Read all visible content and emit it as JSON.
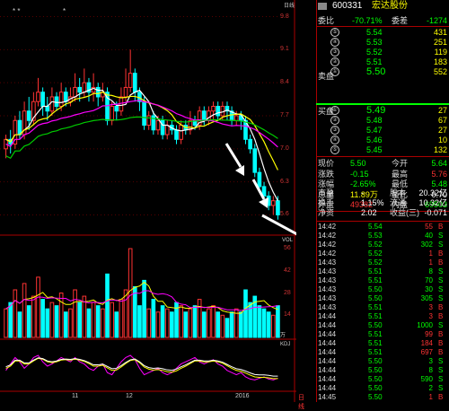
{
  "colors": {
    "up": "#ff3333",
    "down": "#00ffff",
    "ma5": "#ffffff",
    "ma10": "#ffff00",
    "ma20": "#ff00ff",
    "ma60": "#00cc00",
    "arrow": "#ffffff"
  },
  "chart": {
    "top_marks": "* *",
    "top_right_label": "日线",
    "price_ticks": [
      "9.8",
      "9.1",
      "8.4",
      "7.7",
      "7.0",
      "6.3",
      "5.6"
    ],
    "vol_label": "VOL",
    "vol_ticks": [
      "56",
      "42",
      "28",
      "14"
    ],
    "vol_unit": "万",
    "macd_label": "KDJ",
    "date_labels": [
      "11",
      "12",
      "2016"
    ],
    "bottom_unit": "日线",
    "arrow_icon": "down-arrow-icon"
  },
  "header": {
    "code": "600331",
    "name": "宏达股份"
  },
  "stats": {
    "weibi_label": "委比",
    "weibi_value": "-70.71%",
    "weicha_label": "委差",
    "weicha_value": "-1274"
  },
  "sell_label": "卖盘",
  "buy_label": "买盘",
  "asks": [
    {
      "level": "⑤",
      "price": "5.54",
      "vol": "431"
    },
    {
      "level": "④",
      "price": "5.53",
      "vol": "251"
    },
    {
      "level": "③",
      "price": "5.52",
      "vol": "119"
    },
    {
      "level": "②",
      "price": "5.51",
      "vol": "183"
    },
    {
      "level": "①",
      "price": "5.50",
      "vol": "552"
    }
  ],
  "bids": [
    {
      "level": "①",
      "price": "5.49",
      "vol": "27"
    },
    {
      "level": "②",
      "price": "5.48",
      "vol": "67"
    },
    {
      "level": "③",
      "price": "5.47",
      "vol": "27"
    },
    {
      "level": "④",
      "price": "5.46",
      "vol": "10"
    },
    {
      "level": "⑤",
      "price": "5.45",
      "vol": "132"
    }
  ],
  "quote": [
    {
      "l1": "现价",
      "v1": "5.50",
      "l2": "今开",
      "v2": "5.64"
    },
    {
      "l1": "涨跌",
      "v1": "-0.15",
      "l2": "最高",
      "v2": "5.76"
    },
    {
      "l1": "涨幅",
      "v1": "-2.65%",
      "l2": "最低",
      "v2": "5.48"
    },
    {
      "l1": "总量",
      "v1": "11.89万",
      "l2": "量比",
      "v2": "0.70"
    },
    {
      "l1": "外盘",
      "v1": "49382",
      "l2": "内盘",
      "v2": "69503"
    }
  ],
  "fund": [
    {
      "l1": "市盈",
      "v1": "-",
      "l2": "股本",
      "v2": "20.32亿"
    },
    {
      "l1": "换手",
      "v1": "1.15%",
      "l2": "流通",
      "v2": "10.32亿"
    },
    {
      "l1": "净资",
      "v1": "2.02",
      "l2": "收益(三)",
      "v2": "-0.071"
    }
  ],
  "ticks": [
    {
      "time": "14:42",
      "price": "5.54",
      "vol": "55",
      "dir": "B"
    },
    {
      "time": "14:42",
      "price": "5.53",
      "vol": "40",
      "dir": "S"
    },
    {
      "time": "14:42",
      "price": "5.52",
      "vol": "302",
      "dir": "S"
    },
    {
      "time": "14:42",
      "price": "5.52",
      "vol": "1",
      "dir": "B"
    },
    {
      "time": "14:43",
      "price": "5.52",
      "vol": "1",
      "dir": "B"
    },
    {
      "time": "14:43",
      "price": "5.51",
      "vol": "8",
      "dir": "S"
    },
    {
      "time": "14:43",
      "price": "5.51",
      "vol": "70",
      "dir": "S"
    },
    {
      "time": "14:43",
      "price": "5.50",
      "vol": "30",
      "dir": "S"
    },
    {
      "time": "14:43",
      "price": "5.50",
      "vol": "305",
      "dir": "S"
    },
    {
      "time": "14:43",
      "price": "5.51",
      "vol": "3",
      "dir": "B"
    },
    {
      "time": "14:44",
      "price": "5.51",
      "vol": "3",
      "dir": "B"
    },
    {
      "time": "14:44",
      "price": "5.50",
      "vol": "1000",
      "dir": "S"
    },
    {
      "time": "14:44",
      "price": "5.51",
      "vol": "99",
      "dir": "B"
    },
    {
      "time": "14:44",
      "price": "5.51",
      "vol": "184",
      "dir": "B"
    },
    {
      "time": "14:44",
      "price": "5.51",
      "vol": "697",
      "dir": "B"
    },
    {
      "time": "14:44",
      "price": "5.50",
      "vol": "3",
      "dir": "S"
    },
    {
      "time": "14:44",
      "price": "5.50",
      "vol": "8",
      "dir": "S"
    },
    {
      "time": "14:44",
      "price": "5.50",
      "vol": "590",
      "dir": "S"
    },
    {
      "time": "14:44",
      "price": "5.50",
      "vol": "2",
      "dir": "S"
    },
    {
      "time": "14:45",
      "price": "5.50",
      "vol": "1",
      "dir": "B"
    }
  ],
  "candles": [
    [
      7.0,
      7.2,
      6.8,
      7.3
    ],
    [
      7.2,
      7.1,
      6.9,
      7.4
    ],
    [
      7.1,
      7.6,
      7.0,
      7.7
    ],
    [
      7.6,
      7.3,
      7.2,
      7.8
    ],
    [
      7.3,
      7.8,
      7.2,
      8.0
    ],
    [
      7.8,
      7.6,
      7.4,
      8.1
    ],
    [
      7.6,
      8.0,
      7.5,
      8.2
    ],
    [
      8.0,
      8.2,
      7.9,
      8.5
    ],
    [
      8.2,
      7.9,
      7.7,
      8.3
    ],
    [
      7.9,
      7.8,
      7.6,
      8.1
    ],
    [
      7.8,
      8.1,
      7.7,
      8.3
    ],
    [
      8.1,
      7.9,
      7.8,
      8.2
    ],
    [
      7.9,
      8.2,
      7.8,
      8.4
    ],
    [
      8.2,
      8.0,
      7.9,
      8.3
    ],
    [
      8.0,
      8.1,
      7.9,
      8.3
    ],
    [
      8.1,
      8.3,
      8.0,
      8.6
    ],
    [
      8.3,
      8.2,
      8.0,
      8.5
    ],
    [
      8.2,
      8.4,
      8.1,
      8.7
    ],
    [
      8.4,
      8.2,
      8.0,
      8.5
    ],
    [
      8.2,
      8.3,
      8.0,
      8.6
    ],
    [
      8.3,
      8.1,
      7.9,
      8.4
    ],
    [
      8.1,
      8.2,
      8.0,
      8.4
    ],
    [
      8.2,
      7.6,
      7.5,
      8.3
    ],
    [
      7.6,
      7.9,
      7.5,
      8.0
    ],
    [
      7.9,
      7.8,
      7.6,
      8.0
    ],
    [
      7.8,
      8.1,
      7.7,
      8.3
    ],
    [
      8.1,
      8.3,
      8.0,
      8.7
    ],
    [
      8.3,
      8.6,
      8.2,
      9.1
    ],
    [
      8.6,
      8.2,
      8.0,
      8.7
    ],
    [
      8.2,
      8.0,
      7.8,
      8.3
    ],
    [
      8.0,
      7.5,
      7.4,
      8.1
    ],
    [
      7.5,
      7.7,
      7.4,
      7.8
    ],
    [
      7.7,
      7.4,
      7.3,
      7.8
    ],
    [
      7.4,
      7.6,
      7.3,
      7.7
    ],
    [
      7.6,
      7.3,
      7.2,
      7.7
    ],
    [
      7.3,
      7.5,
      7.2,
      7.6
    ],
    [
      7.5,
      7.4,
      7.3,
      7.6
    ],
    [
      7.4,
      7.2,
      7.1,
      7.5
    ],
    [
      7.2,
      7.5,
      7.1,
      7.6
    ],
    [
      7.5,
      7.4,
      7.3,
      7.6
    ],
    [
      7.4,
      7.6,
      7.3,
      7.8
    ],
    [
      7.6,
      7.5,
      7.4,
      7.7
    ],
    [
      7.5,
      7.8,
      7.4,
      7.9
    ],
    [
      7.8,
      7.6,
      7.5,
      7.9
    ],
    [
      7.6,
      7.8,
      7.5,
      7.9
    ],
    [
      7.8,
      7.9,
      7.6,
      8.0
    ],
    [
      7.9,
      7.7,
      7.6,
      8.0
    ],
    [
      7.7,
      7.9,
      7.6,
      8.0
    ],
    [
      7.9,
      7.8,
      7.6,
      8.0
    ],
    [
      7.8,
      7.6,
      7.5,
      7.9
    ],
    [
      7.6,
      7.7,
      7.5,
      7.8
    ],
    [
      7.7,
      7.6,
      7.4,
      7.8
    ],
    [
      7.6,
      7.2,
      7.1,
      7.7
    ],
    [
      7.2,
      7.0,
      6.9,
      7.3
    ],
    [
      7.0,
      6.5,
      6.4,
      7.1
    ],
    [
      6.5,
      6.2,
      6.1,
      6.6
    ],
    [
      6.2,
      6.0,
      5.9,
      6.3
    ],
    [
      6.0,
      5.8,
      5.7,
      6.1
    ],
    [
      5.8,
      5.9,
      5.6,
      6.0
    ],
    [
      5.9,
      5.6,
      5.5,
      6.0
    ]
  ],
  "volumes": [
    18,
    22,
    30,
    16,
    34,
    20,
    26,
    38,
    24,
    18,
    22,
    20,
    28,
    16,
    18,
    30,
    22,
    26,
    18,
    22,
    20,
    18,
    40,
    22,
    16,
    24,
    30,
    56,
    32,
    20,
    36,
    18,
    24,
    16,
    20,
    18,
    16,
    22,
    20,
    16,
    18,
    20,
    24,
    16,
    18,
    20,
    16,
    14,
    12,
    16,
    18,
    16,
    30,
    22,
    26,
    20,
    18,
    16,
    14,
    20
  ],
  "kdj": [
    [
      40,
      55,
      70,
      60,
      45,
      55,
      70,
      75,
      60,
      50,
      55,
      62,
      70,
      65,
      60,
      70,
      60,
      55,
      45,
      40,
      50,
      55,
      35,
      30,
      45,
      60,
      70,
      75,
      65,
      45,
      30,
      35,
      40,
      45,
      35,
      30,
      35,
      45,
      55,
      60,
      65,
      70,
      60,
      55,
      60,
      65,
      55,
      50,
      40,
      35,
      30,
      35,
      25,
      20,
      18,
      22,
      25,
      20,
      18,
      22
    ],
    [
      45,
      50,
      62,
      62,
      55,
      55,
      62,
      68,
      66,
      60,
      58,
      60,
      64,
      65,
      64,
      66,
      64,
      61,
      56,
      50,
      50,
      52,
      46,
      40,
      41,
      48,
      56,
      63,
      65,
      58,
      48,
      43,
      41,
      42,
      40,
      37,
      36,
      39,
      45,
      50,
      56,
      62,
      62,
      60,
      60,
      62,
      60,
      57,
      51,
      45,
      40,
      38,
      34,
      29,
      25,
      24,
      24,
      23,
      21,
      21
    ]
  ]
}
